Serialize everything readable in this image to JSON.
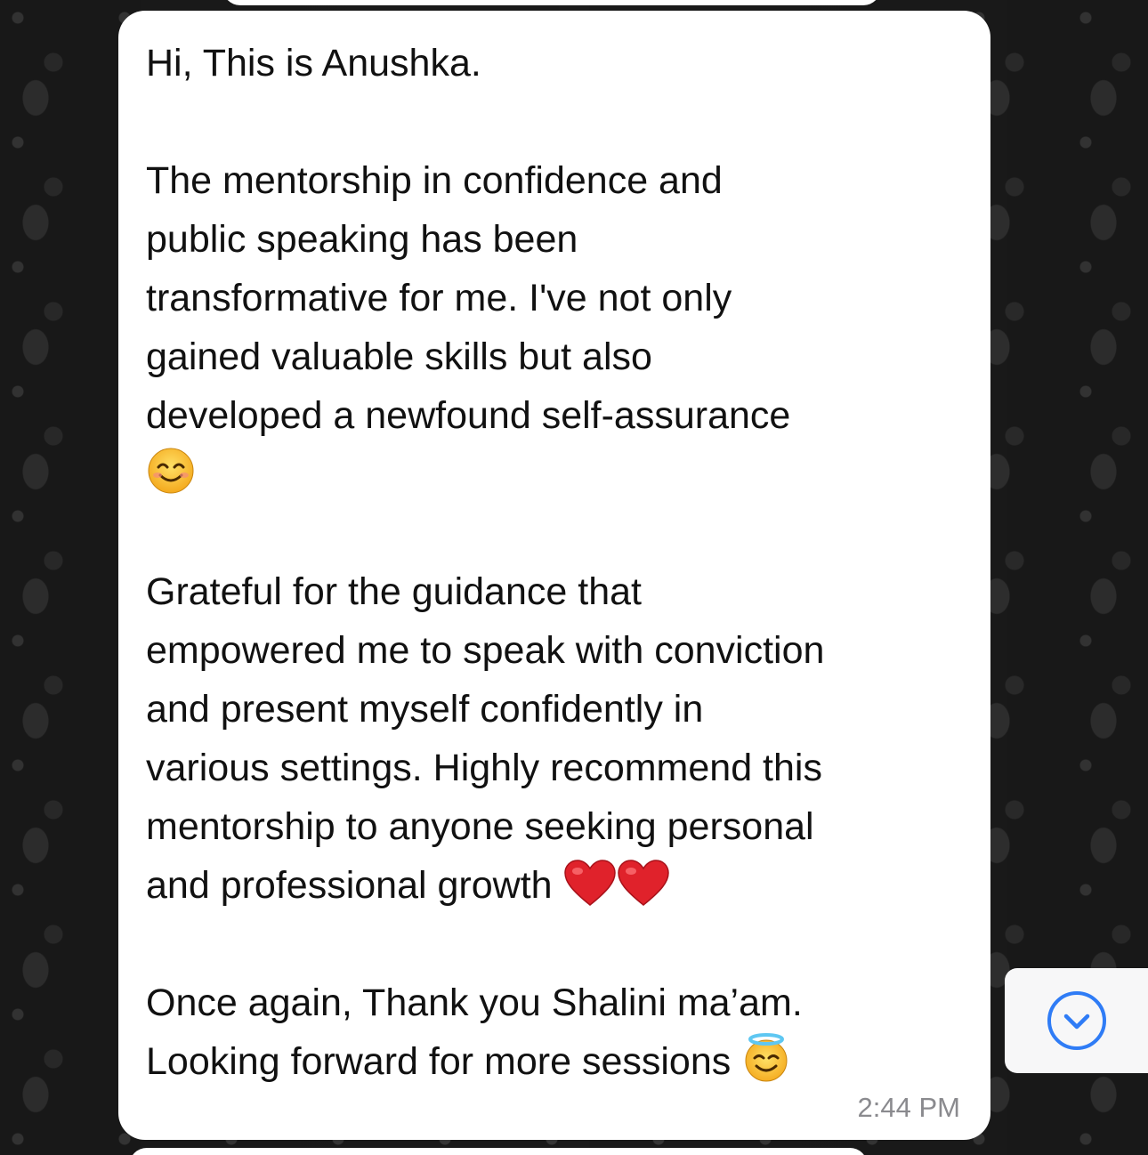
{
  "chat": {
    "message": {
      "greeting": "Hi, This is Anushka.",
      "paragraph1": "The mentorship in confidence and\npublic speaking has been\ntransformative for me. I've not only\ngained valuable skills but also\ndeveloped a newfound self-assurance\n",
      "paragraph2": "Grateful for the guidance that\nempowered me to speak with conviction\nand present myself confidently in\nvarious settings. Highly recommend this\nmentorship to anyone seeking personal\nand professional growth ",
      "paragraph3": "Once again, Thank you Shalini ma’am.\nLooking forward for more sessions ",
      "timestamp": "2:44 PM"
    },
    "emojis": {
      "smile": "smiling-face-with-smiling-eyes",
      "hearts": "red-heart",
      "halo": "smiling-face-with-halo"
    },
    "scroll_button": {
      "icon": "chevron-down-circle-icon"
    }
  },
  "colors": {
    "bubble": "#ffffff",
    "accent": "#2f7cf6",
    "timestamp": "#8a8a8e",
    "text": "#111111"
  }
}
